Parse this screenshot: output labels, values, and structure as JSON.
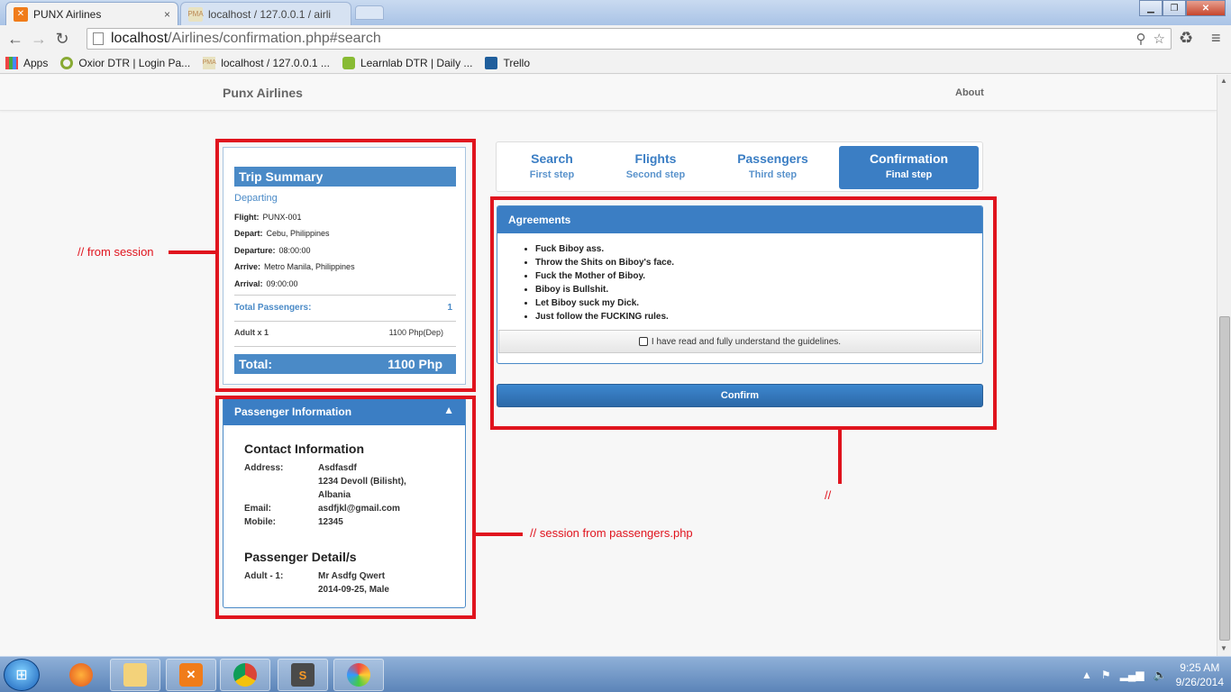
{
  "browser": {
    "tabs": [
      {
        "title": "PUNX Airlines",
        "close": "×"
      },
      {
        "title": "localhost / 127.0.0.1 / airli"
      }
    ],
    "url_host": "localhost",
    "url_path": "/Airlines/confirmation.php#search",
    "bookmarks": [
      {
        "label": "Apps",
        "icon": "apps-grid-icon"
      },
      {
        "label": "Oxior DTR | Login Pa...",
        "icon": "oxior-icon"
      },
      {
        "label": "localhost / 127.0.0.1 ...",
        "icon": "phpmyadmin-icon"
      },
      {
        "label": "Learnlab DTR | Daily ...",
        "icon": "learnlab-icon"
      },
      {
        "label": "Trello",
        "icon": "trello-icon"
      }
    ]
  },
  "navbar": {
    "brand": "Punx Airlines",
    "about": "About"
  },
  "trip_summary": {
    "title": "Trip Summary",
    "departing": "Departing",
    "rows": [
      {
        "label": "Flight:",
        "value": "PUNX-001"
      },
      {
        "label": "Depart:",
        "value": "Cebu, Philippines"
      },
      {
        "label": "Departure:",
        "value": "08:00:00"
      },
      {
        "label": "Arrive:",
        "value": "Metro Manila, Philippines"
      },
      {
        "label": "Arrival:",
        "value": "09:00:00"
      }
    ],
    "total_passengers_label": "Total Passengers:",
    "total_passengers_value": "1",
    "adult_label": "Adult x 1",
    "adult_value": "1100 Php(Dep)",
    "total_label": "Total:",
    "total_value": "1100 Php"
  },
  "passenger_info": {
    "title": "Passenger Information",
    "contact_title": "Contact Information",
    "address_label": "Address:",
    "address_lines": [
      "Asdfasdf",
      "1234 Devoll (Bilisht),",
      "Albania"
    ],
    "email_label": "Email:",
    "email_value": "asdfjkl@gmail.com",
    "mobile_label": "Mobile:",
    "mobile_value": "12345",
    "details_title": "Passenger Detail/s",
    "passenger_label": "Adult - 1:",
    "passenger_lines": [
      "Mr Asdfg Qwert",
      "2014-09-25, Male"
    ]
  },
  "wizard": {
    "steps": [
      {
        "title": "Search",
        "sub": "First step"
      },
      {
        "title": "Flights",
        "sub": "Second step"
      },
      {
        "title": "Passengers",
        "sub": "Third step"
      },
      {
        "title": "Confirmation",
        "sub": "Final step"
      }
    ],
    "active_step": 3
  },
  "agreements": {
    "title": "Agreements",
    "items": [
      "Fuck Biboy ass.",
      "Throw the Shits on Biboy's face.",
      "Fuck the Mother of Biboy.",
      "Biboy is Bullshit.",
      "Let Biboy suck my Dick.",
      "Just follow the FUCKING rules."
    ],
    "checkbox_label": "I have read and fully understand the guidelines.",
    "confirm_label": "Confirm"
  },
  "annotations": {
    "from_session": "// from session",
    "session_passengers": "// session from passengers.php",
    "right_note": "//"
  },
  "taskbar": {
    "time": "9:25 AM",
    "date": "9/26/2014"
  },
  "colors": {
    "accent_blue": "#3b7ec4",
    "annotation_red": "#e0141e"
  }
}
